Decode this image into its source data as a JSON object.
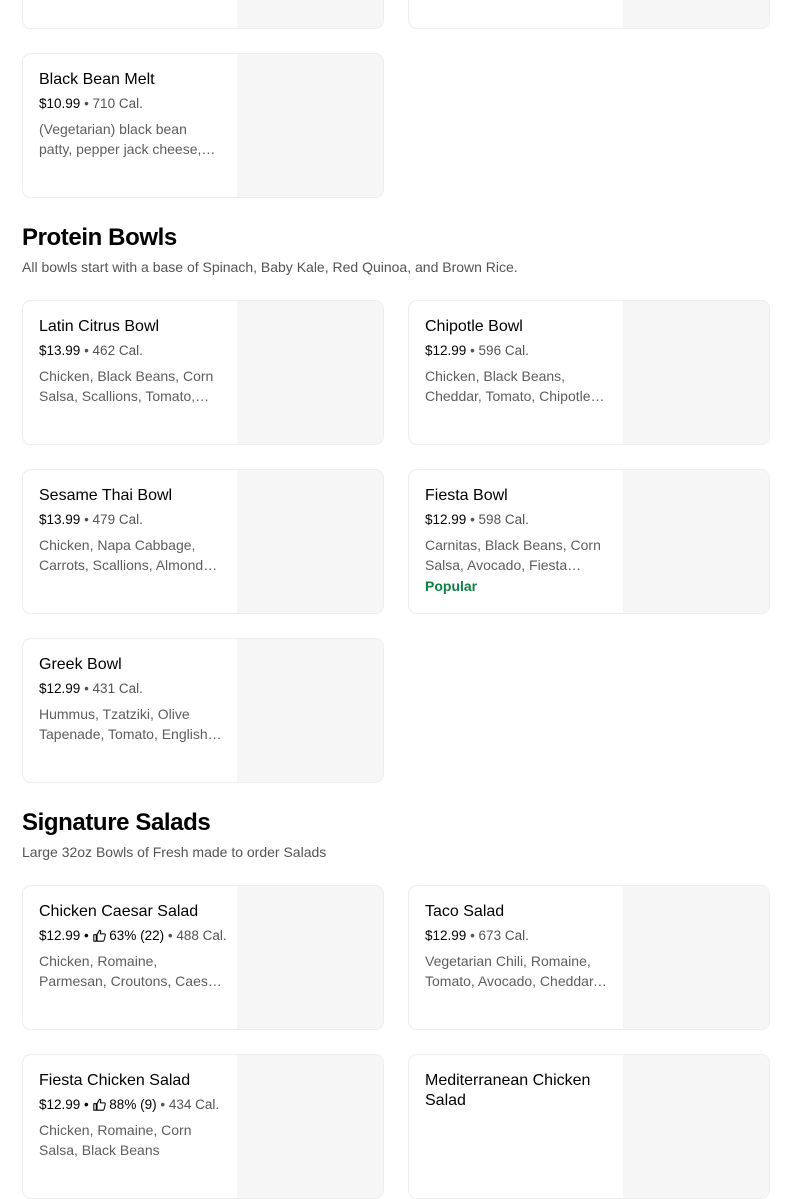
{
  "top_partial_cards": [
    {},
    {}
  ],
  "prev_section_items": [
    {
      "name": "Black Bean Melt",
      "price": "$10.99",
      "calories": "710 Cal.",
      "description": "(Vegetarian) black bean patty, pepper jack cheese, lettuce, tomato"
    }
  ],
  "sections": [
    {
      "title": "Protein Bowls",
      "subtitle": "All bowls start with a base of Spinach, Baby Kale, Red Quinoa, and Brown Rice.",
      "items": [
        {
          "name": "Latin Citrus Bowl",
          "price": "$13.99",
          "calories": "462 Cal.",
          "description": "Chicken, Black Beans, Corn Salsa, Scallions, Tomato, Avocado"
        },
        {
          "name": "Chipotle Bowl",
          "price": "$12.99",
          "calories": "596 Cal.",
          "description": "Chicken, Black Beans, Cheddar, Tomato, Chipotle Ranch"
        },
        {
          "name": "Sesame Thai Bowl",
          "price": "$13.99",
          "calories": "479 Cal.",
          "description": "Chicken, Napa Cabbage, Carrots, Scallions, Almonds, Thai Dressing"
        },
        {
          "name": "Fiesta Bowl",
          "price": "$12.99",
          "calories": "598 Cal.",
          "description": "Carnitas, Black Beans, Corn Salsa, Avocado, Fiesta Dressing",
          "badge": "Popular"
        },
        {
          "name": "Greek Bowl",
          "price": "$12.99",
          "calories": "431 Cal.",
          "description": "Hummus, Tzatziki, Olive Tapenade, Tomato, English Cucumber"
        }
      ]
    },
    {
      "title": "Signature Salads",
      "subtitle": "Large 32oz Bowls of Fresh made to order Salads",
      "items": [
        {
          "name": "Chicken Caesar Salad",
          "price": "$12.99",
          "rating": "63% (22)",
          "calories": "488 Cal.",
          "description": "Chicken, Romaine, Parmesan, Croutons, Caesar Dressing"
        },
        {
          "name": "Taco Salad",
          "price": "$12.99",
          "calories": "673 Cal.",
          "description": "Vegetarian Chili, Romaine, Tomato, Avocado, Cheddar, Tortilla Strips"
        },
        {
          "name": "Fiesta Chicken Salad",
          "price": "$12.99",
          "rating": "88% (9)",
          "calories": "434 Cal.",
          "description": "Chicken, Romaine, Corn Salsa, Black Beans"
        },
        {
          "name": "Mediterranean Chicken Salad",
          "price": "",
          "calories": "",
          "description": ""
        }
      ]
    }
  ]
}
